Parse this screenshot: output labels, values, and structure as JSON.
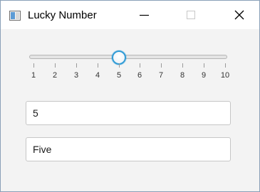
{
  "window": {
    "title": "Lucky Number"
  },
  "slider": {
    "min": 1,
    "max": 10,
    "value": 5,
    "tick_labels": [
      "1",
      "2",
      "3",
      "4",
      "5",
      "6",
      "7",
      "8",
      "9",
      "10"
    ]
  },
  "fields": {
    "number_value": "5",
    "word_value": "Five"
  },
  "colors": {
    "accent": "#2f9bd6",
    "window_background": "#f3f3f3",
    "titlebar_background": "#ffffff"
  },
  "icons": {
    "app": "app-window-icon",
    "minimize": "minimize-icon",
    "maximize": "maximize-icon",
    "close": "close-icon"
  }
}
